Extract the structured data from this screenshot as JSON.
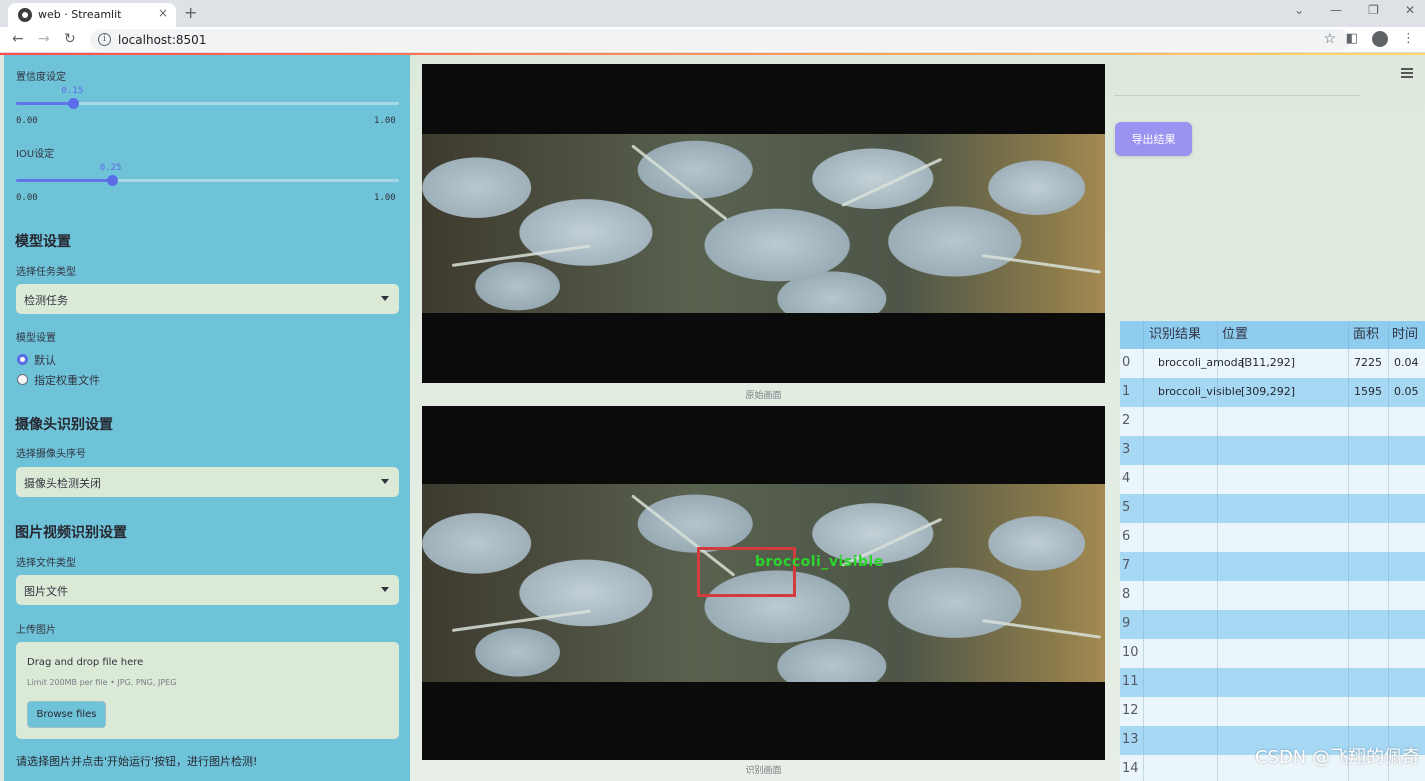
{
  "browser": {
    "tab_title": "web · Streamlit",
    "tab_close": "×",
    "new_tab": "+",
    "url": "localhost:8501",
    "win_min": "—",
    "win_restore": "❐",
    "win_close": "✕"
  },
  "sidebar": {
    "conf_label": "置信度设定",
    "conf": {
      "value": 0.15,
      "value_text": "0.15",
      "min": "0.00",
      "max": "1.00"
    },
    "iou_label": "IOU设定",
    "iou": {
      "value": 0.25,
      "value_text": "0.25",
      "min": "0.00",
      "max": "1.00"
    },
    "model_heading": "模型设置",
    "task_label": "选择任务类型",
    "task_value": "检测任务",
    "model_label": "模型设置",
    "radio_default": "默认",
    "radio_custom": "指定权重文件",
    "camera_heading": "摄像头识别设置",
    "camera_label": "选择摄像头序号",
    "camera_value": "摄像头检测关闭",
    "media_heading": "图片视频识别设置",
    "filetype_label": "选择文件类型",
    "filetype_value": "图片文件",
    "upload_label": "上传图片",
    "upload_title": "Drag and drop file here",
    "upload_limit": "Limit 200MB per file • JPG, PNG, JPEG",
    "browse_label": "Browse files",
    "hint": "请选择图片并点击'开始运行'按钮，进行图片检测!"
  },
  "main": {
    "caption_original": "原始画面",
    "caption_detect": "识别画面",
    "det_label": "broccoli_visible",
    "export_label": "导出结果"
  },
  "table": {
    "headers": [
      "识别结果",
      "位置",
      "面积",
      "时间"
    ],
    "rows": [
      {
        "idx": "0",
        "result": "broccoli_amodal",
        "pos": "[311,292]",
        "area": "7225",
        "time": "0.04"
      },
      {
        "idx": "1",
        "result": "broccoli_visible",
        "pos": "[309,292]",
        "area": "1595",
        "time": "0.05"
      },
      {
        "idx": "2"
      },
      {
        "idx": "3"
      },
      {
        "idx": "4"
      },
      {
        "idx": "5"
      },
      {
        "idx": "6"
      },
      {
        "idx": "7"
      },
      {
        "idx": "8"
      },
      {
        "idx": "9"
      },
      {
        "idx": "10"
      },
      {
        "idx": "11"
      },
      {
        "idx": "12"
      },
      {
        "idx": "13"
      },
      {
        "idx": "14"
      }
    ]
  },
  "watermark": "CSDN @飞翔的佩奇",
  "colors": {
    "sidebar": "#6fc3d9",
    "accent": "#5a6ce6",
    "export_button": "#9b93f0",
    "det_box": "#d23c3c",
    "det_text": "#2bd62b"
  }
}
